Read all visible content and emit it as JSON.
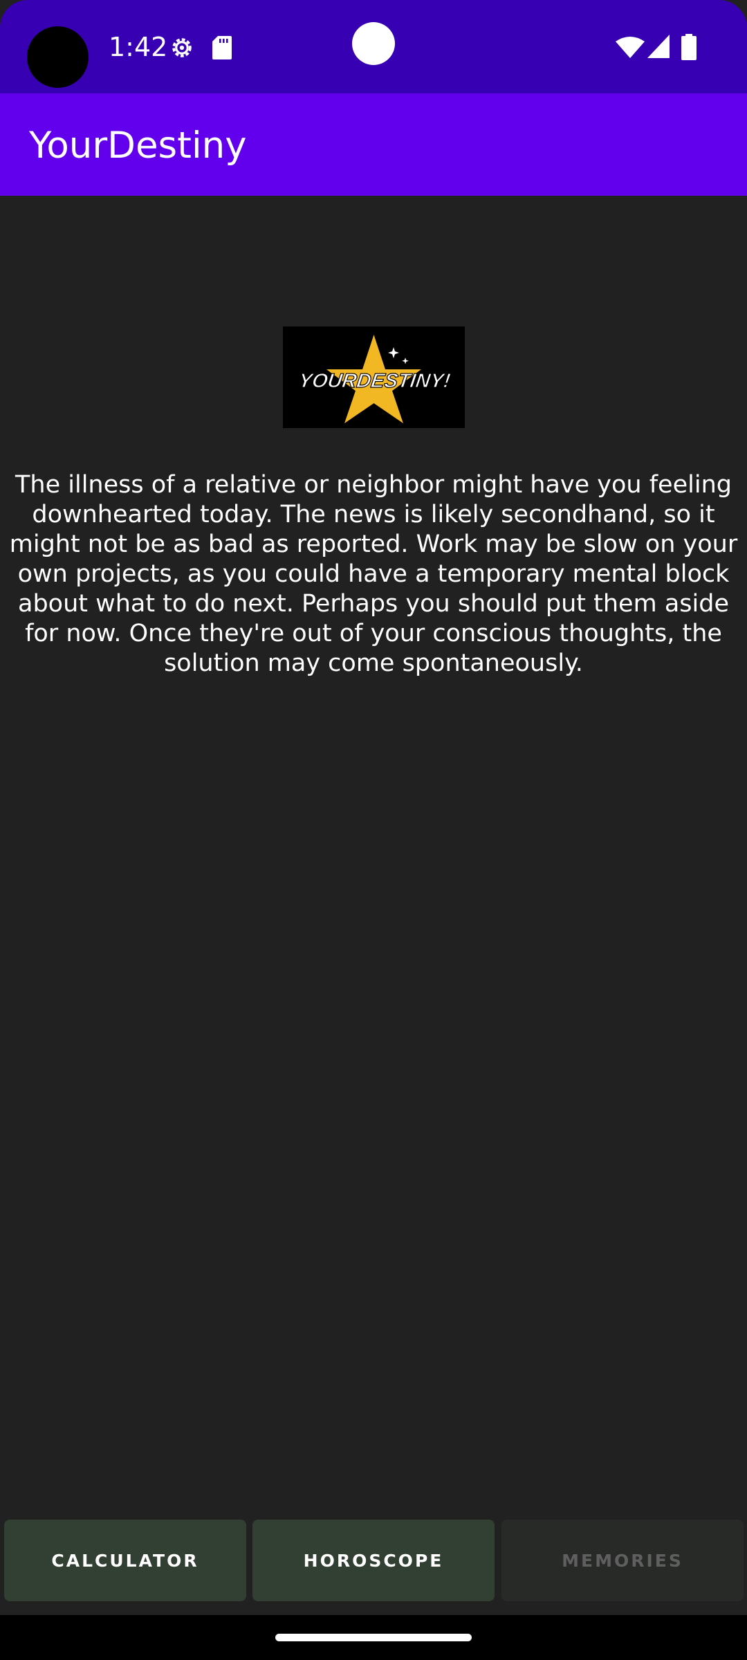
{
  "status_bar": {
    "time": "1:42",
    "icons": [
      "settings-gear-icon",
      "sd-card-icon",
      "wifi-icon",
      "cell-signal-icon",
      "battery-icon"
    ],
    "background": "#3700b3"
  },
  "app_bar": {
    "title": "YourDestiny",
    "background": "#6200ee"
  },
  "logo": {
    "text": "YOURDESTINY!"
  },
  "horoscope": {
    "text": "The illness of a relative or neighbor might have you feeling downhearted today. The news is likely secondhand, so it might not be as bad as reported. Work may be slow on your own projects, as you could have a temporary mental block about what to do next. Perhaps you should put them aside for now. Once they're out of your conscious thoughts, the solution may come spontaneously."
  },
  "bottom_nav": {
    "calculator_label": "CALCULATOR",
    "horoscope_label": "HOROSCOPE",
    "memories_label": "MEMORIES"
  },
  "colors": {
    "background": "#212121",
    "button": "#323f33",
    "button_disabled": "#282a28"
  }
}
